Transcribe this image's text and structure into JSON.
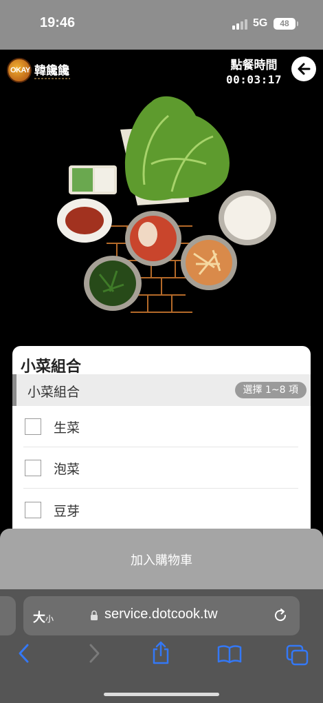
{
  "status_bar": {
    "time": "19:46",
    "network": "5G",
    "battery": "48"
  },
  "header": {
    "logo_text": "韓饞饞",
    "logo_badge": "OKAY",
    "order_time_label": "點餐時間",
    "order_time_value": "00:03:17",
    "back_icon": "arrow-left-icon"
  },
  "hero": {
    "icon": "banchan-dishes-image"
  },
  "card": {
    "title": "小菜組合",
    "section_name": "小菜組合",
    "select_badge": "選擇 1~8 項",
    "options": [
      {
        "label": "生菜",
        "checked": false
      },
      {
        "label": "泡菜",
        "checked": false
      },
      {
        "label": "豆芽",
        "checked": false
      }
    ]
  },
  "cart": {
    "label": "加入購物車"
  },
  "browser": {
    "text_size": "大",
    "text_size_small": "小",
    "url": "service.dotcook.tw",
    "icons": [
      "lock-icon",
      "reload-icon",
      "back-icon",
      "forward-icon",
      "share-icon",
      "bookmarks-icon",
      "tabs-icon"
    ]
  },
  "colors": {
    "accent": "#3478f6",
    "card_bg": "#ffffff",
    "sheet_bg": "#a5a5a5"
  }
}
